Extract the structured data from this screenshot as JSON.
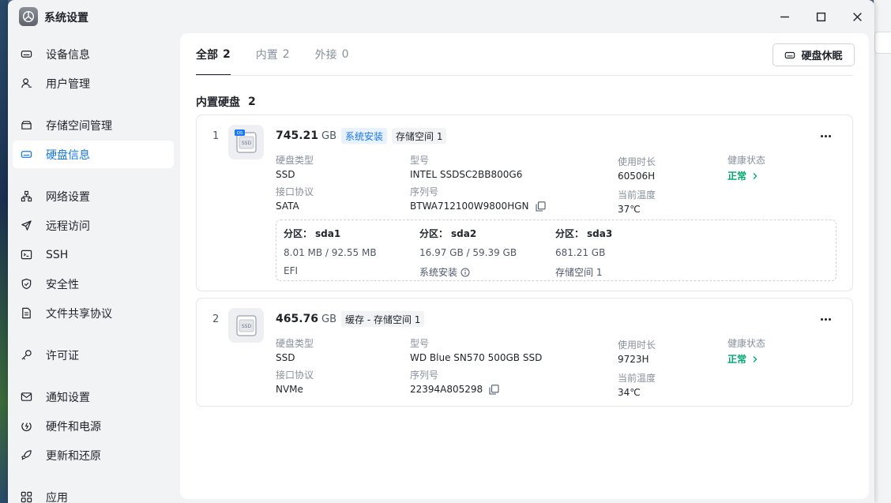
{
  "window": {
    "title": "系统设置"
  },
  "sidebar": {
    "items": [
      {
        "label": "设备信息",
        "icon": "device-icon"
      },
      {
        "label": "用户管理",
        "icon": "user-icon"
      },
      {
        "label": "存储空间管理",
        "icon": "storage-icon"
      },
      {
        "label": "硬盘信息",
        "icon": "disk-icon",
        "active": true
      },
      {
        "label": "网络设置",
        "icon": "network-icon"
      },
      {
        "label": "远程访问",
        "icon": "send-icon"
      },
      {
        "label": "SSH",
        "icon": "terminal-icon"
      },
      {
        "label": "安全性",
        "icon": "shield-icon"
      },
      {
        "label": "文件共享协议",
        "icon": "document-icon"
      },
      {
        "label": "许可证",
        "icon": "key-icon"
      },
      {
        "label": "通知设置",
        "icon": "mail-icon"
      },
      {
        "label": "硬件和电源",
        "icon": "power-icon"
      },
      {
        "label": "更新和还原",
        "icon": "rocket-icon"
      },
      {
        "label": "应用",
        "icon": "apps-icon"
      }
    ]
  },
  "tabs": [
    {
      "label": "全部",
      "count": "2",
      "active": true
    },
    {
      "label": "内置",
      "count": "2"
    },
    {
      "label": "外接",
      "count": "0"
    }
  ],
  "sleep_button": "硬盘休眠",
  "section": {
    "title": "内置硬盘",
    "count": "2"
  },
  "labels": {
    "disk_type": "硬盘类型",
    "model": "型号",
    "usage_time": "使用时长",
    "health": "健康状态",
    "interface": "接口协议",
    "serial": "序列号",
    "temperature": "当前温度"
  },
  "disks": [
    {
      "index": "1",
      "capacity": "745.21",
      "unit": "GB",
      "badge_os": "OS",
      "tags": [
        "系统安装",
        "存储空间 1"
      ],
      "disk_type": "SSD",
      "model": "INTEL SSDSC2BB800G6",
      "usage_time": "60506H",
      "health": "正常",
      "interface": "SATA",
      "serial": "BTWA712100W9800HGN",
      "temperature": "37℃",
      "partitions": [
        {
          "label": "分区：",
          "name": "sda1",
          "size": "8.01 MB / 92.55 MB",
          "usage": "EFI"
        },
        {
          "label": "分区：",
          "name": "sda2",
          "size": "16.97 GB / 59.39 GB",
          "usage": "系统安装"
        },
        {
          "label": "分区：",
          "name": "sda3",
          "size": "681.21 GB",
          "usage": "存储空间 1"
        }
      ]
    },
    {
      "index": "2",
      "capacity": "465.76",
      "unit": "GB",
      "tags": [
        "缓存 - 存储空间 1"
      ],
      "disk_type": "SSD",
      "model": "WD Blue SN570 500GB SSD",
      "usage_time": "9723H",
      "health": "正常",
      "interface": "NVMe",
      "serial": "22394A805298",
      "temperature": "34℃"
    }
  ],
  "colors": {
    "accent": "#1677ff",
    "ok": "#00a870"
  }
}
